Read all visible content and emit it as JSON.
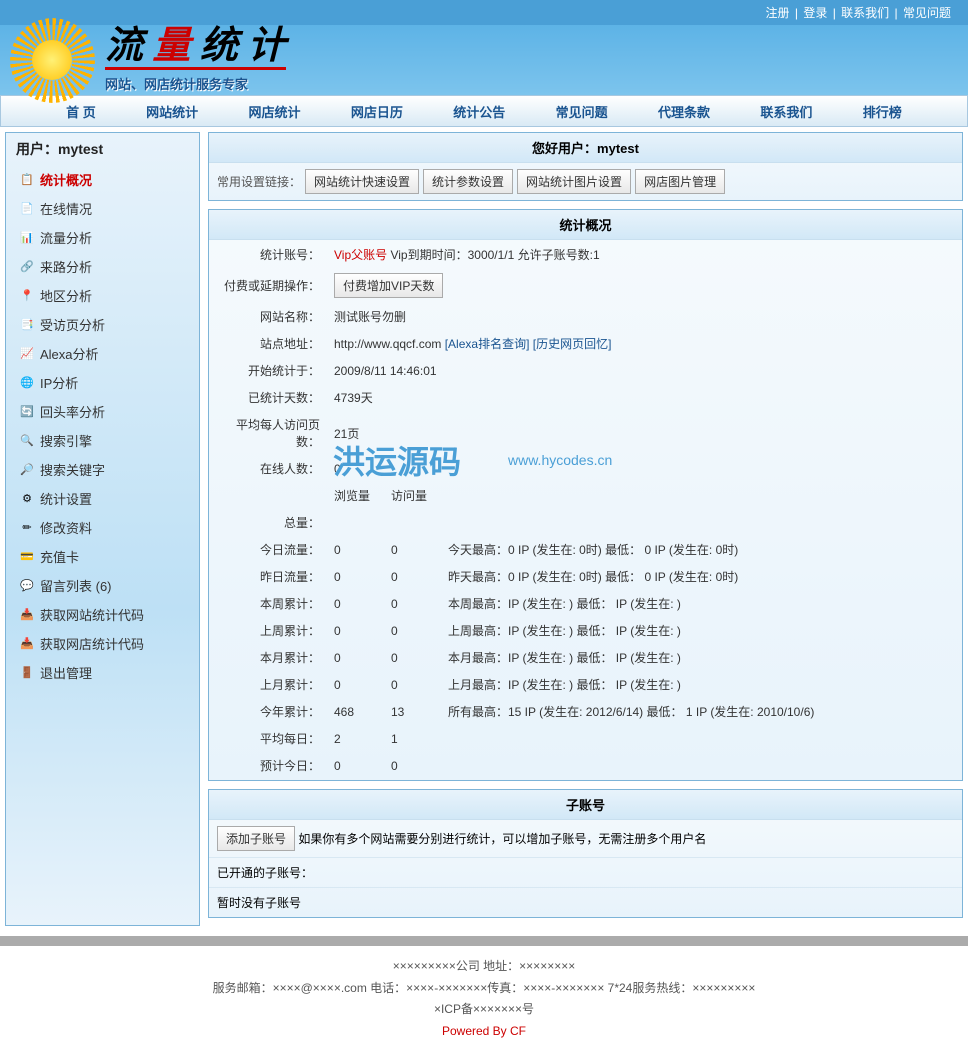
{
  "topLinks": [
    "注册",
    "登录",
    "联系我们",
    "常见问题"
  ],
  "logo": {
    "main1": "流",
    "main2": "量",
    "main3": "统 计",
    "sub": "网站、网店统计服务专家"
  },
  "nav": [
    "首 页",
    "网站统计",
    "网店统计",
    "网店日历",
    "统计公告",
    "常见问题",
    "代理条款",
    "联系我们",
    "排行榜"
  ],
  "sidebar": {
    "title": "用户：mytest",
    "items": [
      {
        "icon": "📋",
        "label": "统计概况",
        "active": true
      },
      {
        "icon": "📄",
        "label": "在线情况"
      },
      {
        "icon": "📊",
        "label": "流量分析"
      },
      {
        "icon": "🔗",
        "label": "来路分析"
      },
      {
        "icon": "📍",
        "label": "地区分析"
      },
      {
        "icon": "📑",
        "label": "受访页分析"
      },
      {
        "icon": "📈",
        "label": "Alexa分析"
      },
      {
        "icon": "🌐",
        "label": "IP分析"
      },
      {
        "icon": "🔄",
        "label": "回头率分析"
      },
      {
        "icon": "🔍",
        "label": "搜索引擎"
      },
      {
        "icon": "🔎",
        "label": "搜索关键字"
      },
      {
        "icon": "⚙",
        "label": "统计设置"
      },
      {
        "icon": "✏",
        "label": "修改资料"
      },
      {
        "icon": "💳",
        "label": "充值卡"
      },
      {
        "icon": "💬",
        "label": "留言列表 (6)"
      },
      {
        "icon": "📥",
        "label": "获取网站统计代码"
      },
      {
        "icon": "📥",
        "label": "获取网店统计代码"
      },
      {
        "icon": "🚪",
        "label": "退出管理"
      }
    ]
  },
  "welcome": {
    "title": "您好用户：mytest",
    "linkLabel": "常用设置链接：",
    "buttons": [
      "网站统计快速设置",
      "统计参数设置",
      "网站统计图片设置",
      "网店图片管理"
    ]
  },
  "overview": {
    "title": "统计概况",
    "account": {
      "label": "统计账号：",
      "vip": "Vip父账号",
      "rest": " Vip到期时间：3000/1/1 允许子账号数:1"
    },
    "pay": {
      "label": "付费或延期操作：",
      "btn": "付费增加VIP天数"
    },
    "siteName": {
      "label": "网站名称：",
      "val": "测试账号勿删"
    },
    "siteUrl": {
      "label": "站点地址：",
      "url": "http://www.qqcf.com",
      "link1": "[Alexa排名查询]",
      "link2": "[历史网页回忆]"
    },
    "startTime": {
      "label": "开始统计于：",
      "val": "2009/8/11 14:46:01"
    },
    "days": {
      "label": "已统计天数：",
      "val": "4739天"
    },
    "avgPages": {
      "label": "平均每人访问页数：",
      "val": "21页"
    },
    "online": {
      "label": "在线人数：",
      "val": "0"
    },
    "cols": {
      "c1": "浏览量",
      "c2": "访问量"
    },
    "totalLabel": "总量：",
    "rows": [
      {
        "label": "今日流量：",
        "pv": "0",
        "uv": "0",
        "extra": "今天最高：0 IP (发生在: 0时)  最低：  0 IP (发生在: 0时)"
      },
      {
        "label": "昨日流量：",
        "pv": "0",
        "uv": "0",
        "extra": "昨天最高：0 IP (发生在: 0时)  最低：  0 IP (发生在: 0时)"
      },
      {
        "label": "本周累计：",
        "pv": "0",
        "uv": "0",
        "extra": "本周最高：IP (发生在: )  最低：  IP (发生在: )"
      },
      {
        "label": "上周累计：",
        "pv": "0",
        "uv": "0",
        "extra": "上周最高：IP (发生在: )  最低：  IP (发生在: )"
      },
      {
        "label": "本月累计：",
        "pv": "0",
        "uv": "0",
        "extra": "本月最高：IP (发生在: )  最低：  IP (发生在: )"
      },
      {
        "label": "上月累计：",
        "pv": "0",
        "uv": "0",
        "extra": "上月最高：IP (发生在: )  最低：  IP (发生在: )"
      },
      {
        "label": "今年累计：",
        "pv": "468",
        "uv": "13",
        "extra": "所有最高：15 IP (发生在: 2012/6/14)  最低：  1 IP (发生在: 2010/10/6)"
      },
      {
        "label": "平均每日：",
        "pv": "2",
        "uv": "1",
        "extra": ""
      },
      {
        "label": "预计今日：",
        "pv": "0",
        "uv": "0",
        "extra": ""
      }
    ]
  },
  "sub": {
    "title": "子账号",
    "btn": "添加子账号",
    "text": "如果你有多个网站需要分别进行统计，可以增加子账号，无需注册多个用户名",
    "opened": "已开通的子账号：",
    "none": "暂时没有子账号"
  },
  "footer": {
    "line1": "×××××××××公司 地址：××××××××",
    "line2": "服务邮箱：××××@××××.com 电话：××××-×××××××传真：××××-××××××× 7*24服务热线：×××××××××",
    "line3": "×ICP备×××××××号",
    "line4": "Powered By CF"
  },
  "watermark": {
    "text": "洪运源码",
    "url": "www.hycodes.cn"
  }
}
